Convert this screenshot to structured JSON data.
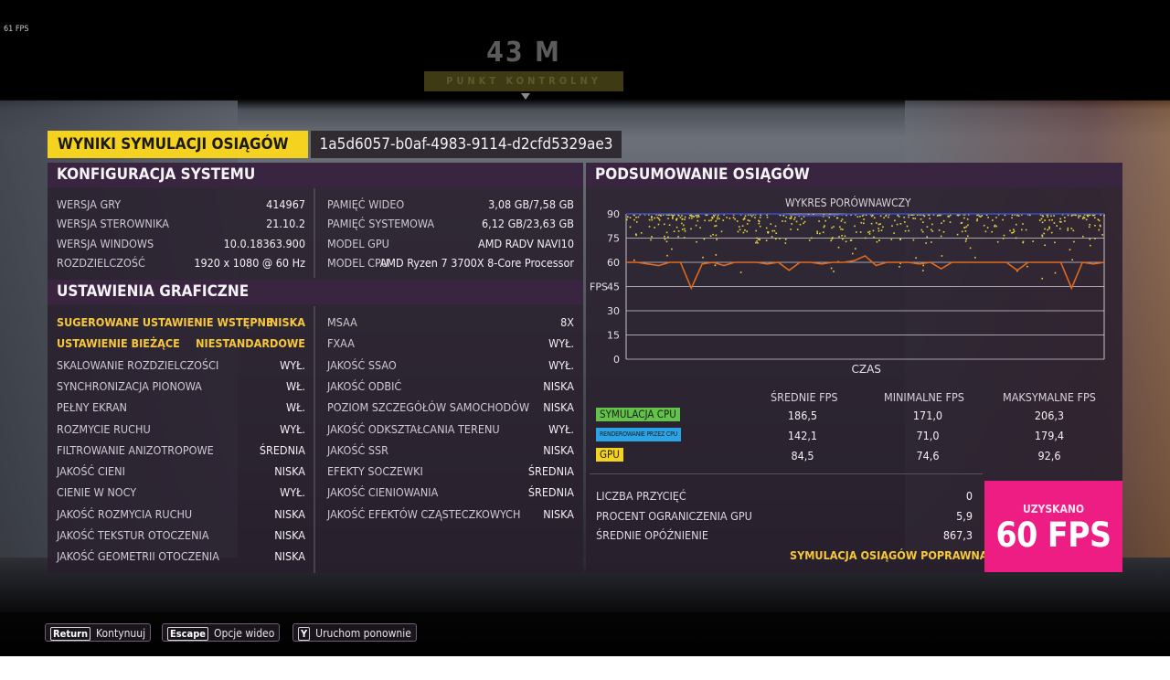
{
  "overlay": {
    "fps": "61 FPS"
  },
  "hud": {
    "distance": "43 M",
    "checkpoint": "PUNKT KONTROLNY"
  },
  "header": {
    "title": "WYNIKI SYMULACJI OSIĄGÓW",
    "run_id": "1a5d6057-b0af-4983-9114-d2cfd5329ae3"
  },
  "system": {
    "heading": "KONFIGURACJA SYSTEMU",
    "left": [
      {
        "k": "WERSJA GRY",
        "v": "414967"
      },
      {
        "k": "WERSJA STEROWNIKA",
        "v": "21.10.2"
      },
      {
        "k": "WERSJA WINDOWS",
        "v": "10.0.18363.900"
      },
      {
        "k": "ROZDZIELCZOŚĆ",
        "v": "1920 x 1080 @ 60 Hz"
      }
    ],
    "right": [
      {
        "k": "PAMIĘĆ WIDEO",
        "v": "3,08 GB/7,58 GB"
      },
      {
        "k": "PAMIĘĆ SYSTEMOWA",
        "v": "6,12 GB/23,63 GB"
      },
      {
        "k": "MODEL GPU",
        "v": "AMD RADV NAVI10"
      },
      {
        "k": "MODEL CPU",
        "v": "AMD Ryzen 7 3700X 8-Core Processor"
      }
    ]
  },
  "graphics": {
    "heading": "USTAWIENIA GRAFICZNE",
    "left": [
      {
        "k": "SUGEROWANE USTAWIENIE WSTĘPNE",
        "v": "NISKA",
        "hl": true
      },
      {
        "k": "USTAWIENIE BIEŻĄCE",
        "v": "NIESTANDARDOWE",
        "hl": true
      },
      {
        "k": "SKALOWANIE ROZDZIELCZOŚCI",
        "v": "WYŁ."
      },
      {
        "k": "SYNCHRONIZACJA PIONOWA",
        "v": "WŁ."
      },
      {
        "k": "PEŁNY EKRAN",
        "v": "WŁ."
      },
      {
        "k": "ROZMYCIE RUCHU",
        "v": "WYŁ."
      },
      {
        "k": "FILTROWANIE ANIZOTROPOWE",
        "v": "ŚREDNIA"
      },
      {
        "k": "JAKOŚĆ CIENI",
        "v": "NISKA"
      },
      {
        "k": "CIENIE W NOCY",
        "v": "WYŁ."
      },
      {
        "k": "JAKOŚĆ ROZMYCIA RUCHU",
        "v": "NISKA"
      },
      {
        "k": "JAKOŚĆ TEKSTUR OTOCZENIA",
        "v": "NISKA"
      },
      {
        "k": "JAKOŚĆ GEOMETRII OTOCZENIA",
        "v": "NISKA"
      }
    ],
    "right": [
      {
        "k": "MSAA",
        "v": "8X"
      },
      {
        "k": "FXAA",
        "v": "WYŁ."
      },
      {
        "k": "JAKOŚĆ SSAO",
        "v": "WYŁ."
      },
      {
        "k": "JAKOŚĆ ODBIĆ",
        "v": "NISKA"
      },
      {
        "k": "POZIOM SZCZEGÓŁÓW SAMOCHODÓW",
        "v": "NISKA"
      },
      {
        "k": "JAKOŚĆ ODKSZTAŁCANIA TERENU",
        "v": "WYŁ."
      },
      {
        "k": "JAKOŚĆ SSR",
        "v": "NISKA"
      },
      {
        "k": "EFEKTY SOCZEWKI",
        "v": "ŚREDNIA"
      },
      {
        "k": "JAKOŚĆ CIENIOWANIA",
        "v": "ŚREDNIA"
      },
      {
        "k": "JAKOŚĆ EFEKTÓW CZĄSTECZKOWYCH",
        "v": "NISKA"
      }
    ]
  },
  "performance": {
    "heading": "PODSUMOWANIE OSIĄGÓW",
    "chart_title": "WYKRES PORÓWNAWCZY",
    "columns": [
      "ŚREDNIE FPS",
      "MINIMALNE FPS",
      "MAKSYMALNE FPS"
    ],
    "rows": [
      {
        "label": "SYMULACJA CPU",
        "color": "#62c24a",
        "values": [
          "186,5",
          "171,0",
          "206,3"
        ]
      },
      {
        "label": "RENDEROWANIE PRZEZ CPU",
        "color": "#2aa4e6",
        "values": [
          "142,1",
          "71,0",
          "179,4"
        ]
      },
      {
        "label": "GPU",
        "color": "#f5d21f",
        "values": [
          "84,5",
          "74,6",
          "92,6"
        ]
      }
    ],
    "stats": [
      {
        "k": "LICZBA PRZYCIĘĆ",
        "v": "0"
      },
      {
        "k": "PROCENT OGRANICZENIA GPU",
        "v": "5,9"
      },
      {
        "k": "ŚREDNIE OPÓŹNIENIE",
        "v": "867,3"
      }
    ],
    "verdict": "SYMULACJA OSIĄGÓW POPRAWNA",
    "result_label": "UZYSKANO",
    "result_value": "60 FPS"
  },
  "chart_data": {
    "type": "line",
    "title": "WYKRES PORÓWNAWCZY",
    "xlabel": "CZAS",
    "ylabel": "FPS",
    "ylim": [
      0,
      90
    ],
    "yticks": [
      "90",
      "75",
      "60",
      "45",
      "30",
      "15",
      "0"
    ],
    "grid": true,
    "series": [
      {
        "color": "#3a4fd8",
        "values": [
          90,
          90,
          90,
          90,
          90,
          90,
          90,
          89,
          89,
          90,
          90,
          90,
          90,
          90,
          90,
          90,
          90,
          90,
          90,
          90
        ]
      },
      {
        "color": "#e06a1e",
        "values": [
          60,
          60,
          59,
          58,
          60,
          60,
          44,
          59,
          60,
          58,
          60,
          60,
          60,
          59,
          60,
          55,
          60,
          60,
          59,
          60,
          60,
          61,
          64,
          58,
          60,
          60,
          60,
          59,
          60,
          56,
          60,
          60,
          60,
          60,
          60,
          60,
          55,
          60,
          60,
          60,
          60,
          44,
          60,
          59,
          60
        ]
      },
      {
        "color": "#e8d640",
        "style": "scatter",
        "range": [
          72,
          90
        ]
      }
    ]
  },
  "footer": {
    "keys": [
      {
        "cap": "Return",
        "label": "Kontynuuj"
      },
      {
        "cap": "Escape",
        "label": "Opcje wideo"
      },
      {
        "cap": "Y",
        "label": "Uruchom ponownie"
      }
    ]
  }
}
